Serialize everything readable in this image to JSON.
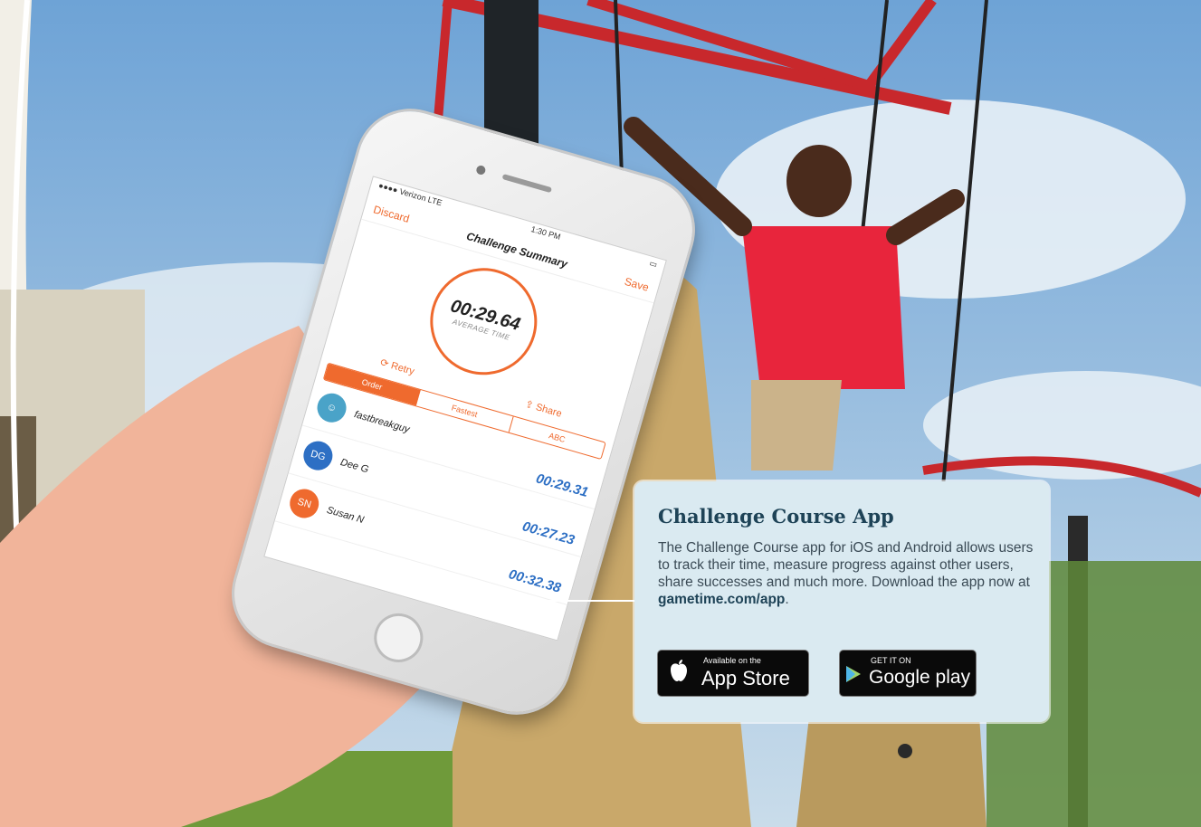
{
  "phone": {
    "status_carrier": "●●●● Verizon  LTE",
    "status_time": "1:30 PM",
    "nav_left": "Discard",
    "nav_title": "Challenge Summary",
    "nav_right": "Save",
    "timer_value": "00:29.64",
    "timer_label": "AVERAGE TIME",
    "retry_label": "Retry",
    "share_label": "Share",
    "tabs": [
      "Order",
      "Fastest",
      "ABC"
    ],
    "entries": [
      {
        "name": "fastbreakguy",
        "initials": "",
        "time": "00:29.31",
        "color": "#4aa3c8"
      },
      {
        "name": "Dee G",
        "initials": "DG",
        "time": "00:27.23",
        "color": "#2d6fc4"
      },
      {
        "name": "Susan N",
        "initials": "SN",
        "time": "00:32.38",
        "color": "#ef6a2e"
      }
    ]
  },
  "card": {
    "title": "Challenge Course App",
    "body": "The Challenge Course app for iOS and Android allows users to track their time, measure progress against other users, share successes and much more. Download the app now at ",
    "link": "gametime.com/app",
    "link_tail": ".",
    "appstore_small": "Available on the",
    "appstore_big": "App Store",
    "gplay_small": "GET IT ON",
    "gplay_big": "Google play"
  },
  "colors": {
    "accent": "#ef6a2e",
    "card_bg": "#daeaf1",
    "title": "#1e4357"
  }
}
